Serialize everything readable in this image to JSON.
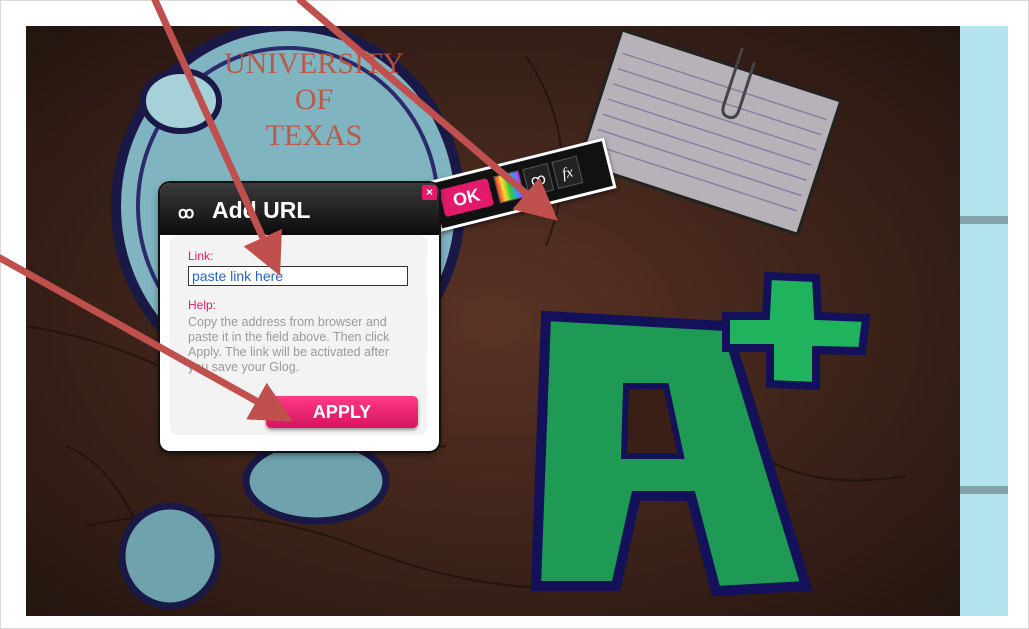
{
  "background": {
    "sticker_text": [
      "UNIVERSITY",
      "OF",
      "TEXAS"
    ]
  },
  "dialog": {
    "title": "Add URL",
    "title_icon": "link-icon",
    "close_label": "×",
    "link_label": "Link:",
    "link_value": "paste link here",
    "help_label": "Help:",
    "help_text": "Copy the address from browser and paste it in the field above. Then click Apply. The link will be activated after you save your Glog.",
    "apply_label": "APPLY"
  },
  "toolbar": {
    "ok_label": "OK",
    "color_icon": "color-palette-icon",
    "link_icon": "link-icon",
    "link_glyph": "ꝏ",
    "fx_label": "fx"
  },
  "colors": {
    "accent": "#e3196b",
    "annotation_arrow": "#c0504d",
    "link_text": "#2a63c4",
    "side_strip": "#b3e3ee"
  }
}
